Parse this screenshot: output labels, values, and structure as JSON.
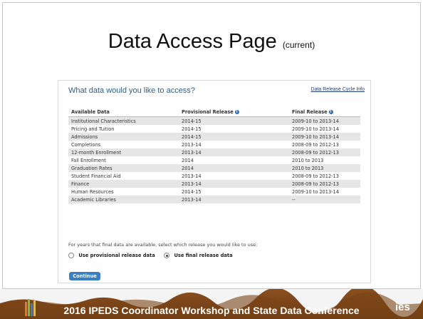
{
  "slide": {
    "title": "Data Access Page",
    "title_sub": "(current)",
    "footer": "2016 IPEDS Coordinator Workshop and State Data Conference",
    "footer_logo": "ies"
  },
  "screenshot": {
    "question": "What data would you like to access?",
    "release_link": "Data Release Cycle Info",
    "table": {
      "headers": [
        "Available Data",
        "Provisional Release",
        "Final Release"
      ],
      "rows": [
        [
          "Institutional Characteristics",
          "2014-15",
          "2009-10 to 2013-14"
        ],
        [
          "Pricing and Tuition",
          "2014-15",
          "2009-10 to 2013-14"
        ],
        [
          "Admissions",
          "2014-15",
          "2009-10 to 2013-14"
        ],
        [
          "Completions",
          "2013-14",
          "2008-09 to 2012-13"
        ],
        [
          "12-month Enrollment",
          "2013-14",
          "2008-09 to 2012-13"
        ],
        [
          "Fall Enrollment",
          "2014",
          "2010 to 2013"
        ],
        [
          "Graduation Rates",
          "2014",
          "2010 to 2013"
        ],
        [
          "Student Financial Aid",
          "2013-14",
          "2008-09 to 2012-13"
        ],
        [
          "Finance",
          "2013-14",
          "2008-09 to 2012-13"
        ],
        [
          "Human Resources",
          "2014-15",
          "2009-10 to 2013-14"
        ],
        [
          "Academic Libraries",
          "2013-14",
          "--"
        ]
      ]
    },
    "prompt": "For years that final data are available, select which release you would like to use:",
    "options": [
      {
        "label": "Use provisional release data",
        "selected": false
      },
      {
        "label": "Use final release data",
        "selected": true
      }
    ],
    "continue_label": "Continue"
  },
  "colors": {
    "accent": "#3a7fc4",
    "banner": "#7a4518",
    "alt_row": "#e6e6e6"
  }
}
